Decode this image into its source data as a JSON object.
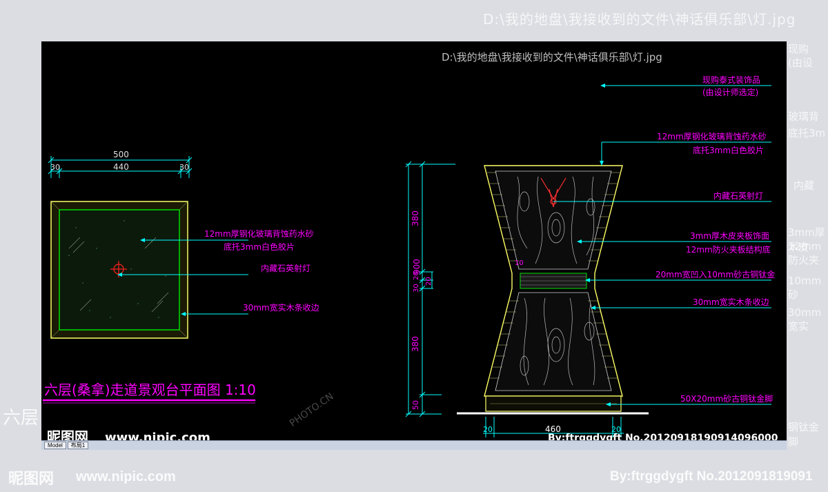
{
  "background": {
    "path_caption": "D:\\我的地盘\\我接收到的文件\\神话俱乐部\\灯.jpg",
    "right_edge_texts": [
      "现购",
      "(由设",
      "玻璃背",
      "底托3m",
      "内藏",
      "3mm厚木皮",
      "12mm防火夹",
      "10mm砂",
      "30mm宽实",
      "钢钛金脚"
    ],
    "left_label": "六层",
    "bottom_logo": "昵图网",
    "bottom_url": "www.nipic.com",
    "bottom_id": "By:ftrggdygft  No.2012091819091"
  },
  "drawing": {
    "path_caption": "D:\\我的地盘\\我接收到的文件\\神话俱乐部\\灯.jpg",
    "plan": {
      "title": "六层(桑拿)走道景观台平面图 1:10",
      "dim_total": "500",
      "dim_inner": "440",
      "dim_left": "30",
      "dim_right": "30",
      "labels": [
        "12mm厚钢化玻璃背蚀药水砂",
        "底托3mm白色胶片",
        "内藏石英射灯",
        "30mm宽实木条收边"
      ]
    },
    "elevation": {
      "dim_total": "900",
      "dim_top": "380",
      "dim_mid_a": "20",
      "dim_mid_b": "30",
      "dim_mid_c": "20",
      "dim_bottom": "380",
      "dim_foot": "50",
      "dim_mid_right": "10",
      "dim_side_label": "10",
      "dim_bottom_left": "20",
      "dim_bottom_center": "460",
      "dim_bottom_right": "20",
      "labels": [
        "现购泰式装饰品",
        "(由设计师选定)",
        "12mm厚钢化玻璃背蚀药水砂",
        "底托3mm白色胶片",
        "内藏石英射灯",
        "3mm厚木皮夹板饰面",
        "12mm防火夹板结构底",
        "20mm宽凹入10mm砂古铜钛金",
        "30mm宽实木条收边",
        "50X20mm砂古铜钛金脚"
      ]
    },
    "logo": "昵图网",
    "url": "www.nipic.com",
    "id_text": "By:ftrggdygft  No.20120918190914096000",
    "watermark": "PHOTO.CN"
  },
  "statusbar": {
    "tabs": [
      "Model",
      "布局1"
    ]
  },
  "colors": {
    "dimension": "#00ffff",
    "label": "#ff00ff",
    "outline": "#ffff66",
    "green": "#00dd00",
    "ground": "#ffffff"
  }
}
